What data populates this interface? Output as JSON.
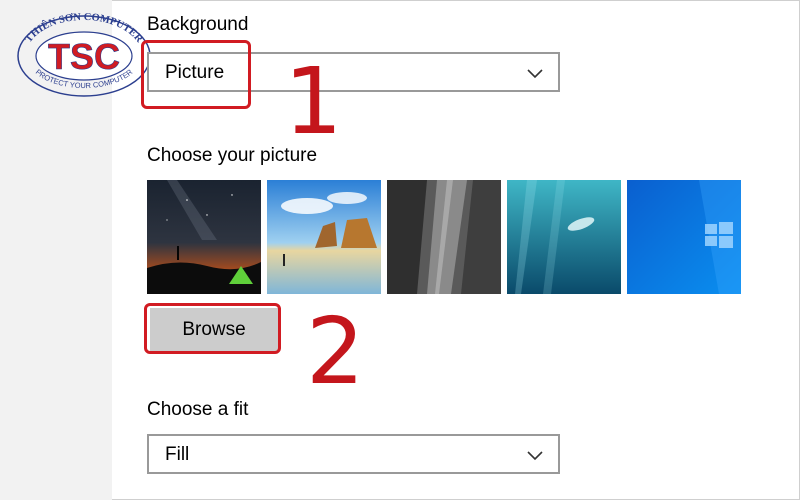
{
  "logo": {
    "initials": "TSC",
    "ring_top": "THIÊN SƠN COMPUTER",
    "ring_bottom": "PROTECT YOUR COMPUTER",
    "color_red": "#d11b22",
    "color_blue": "#2c3f8f"
  },
  "background": {
    "label": "Background",
    "selected": "Picture"
  },
  "picture": {
    "label": "Choose your picture",
    "thumbnails": [
      "night-sky-tent",
      "beach-rock-arch",
      "rock-cliff-face",
      "underwater-swimmer",
      "windows-10-blue"
    ]
  },
  "browse": {
    "label": "Browse"
  },
  "fit": {
    "label": "Choose a fit",
    "selected": "Fill"
  },
  "annotations": {
    "step1": "1",
    "step2": "2",
    "color": "#d11b22"
  }
}
